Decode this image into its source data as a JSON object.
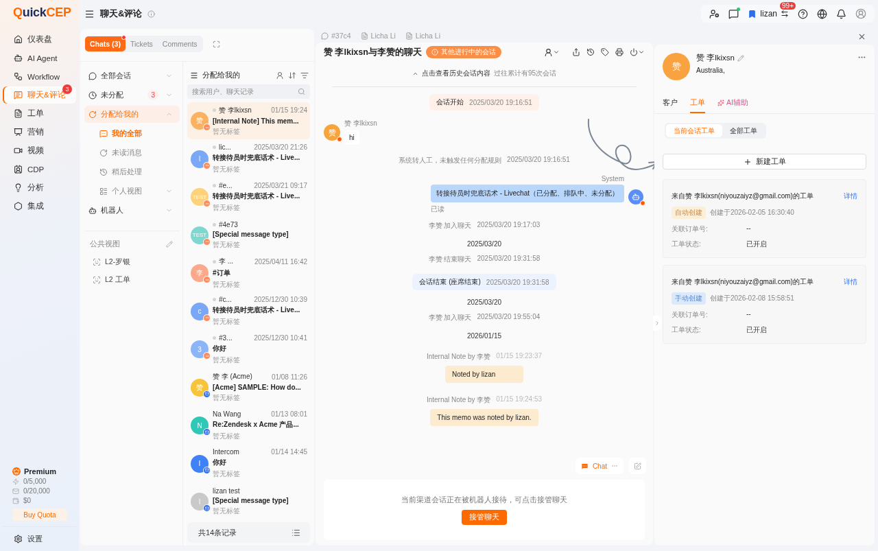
{
  "logo": {
    "mark": "Q",
    "rest": "uick",
    "accent": "CEP"
  },
  "nav": [
    {
      "label": "仪表盘",
      "selected": false
    },
    {
      "label": "AI Agent",
      "selected": false
    },
    {
      "label": "Workflow",
      "selected": false
    },
    {
      "label": "聊天&评论",
      "selected": true,
      "badge": "3"
    },
    {
      "label": "工单",
      "selected": false
    },
    {
      "label": "营销",
      "selected": false
    },
    {
      "label": "视频",
      "selected": false
    },
    {
      "label": "CDP",
      "selected": false
    },
    {
      "label": "分析",
      "selected": false
    },
    {
      "label": "集成",
      "selected": false
    }
  ],
  "plan": {
    "name": "Premium",
    "quotas": [
      "0/5,000",
      "0/20,000",
      "$0"
    ],
    "button": "Buy Quota"
  },
  "settings": "设置",
  "header": {
    "title": "聊天&评论",
    "user": "lizan",
    "notice_badge": "99+"
  },
  "panel_tabs": [
    {
      "label": "Chats (3)",
      "selected": true,
      "dot": true
    },
    {
      "label": "Tickets",
      "selected": false,
      "dot": false
    },
    {
      "label": "Comments",
      "selected": false,
      "dot": false
    }
  ],
  "folders": [
    {
      "label": "全部会话",
      "selected": false,
      "expanded": false
    },
    {
      "label": "未分配",
      "count": "3",
      "selected": false,
      "expanded": false
    },
    {
      "label": "分配给我的",
      "selected": true,
      "expanded": true,
      "children": [
        {
          "label": "我的全部",
          "selected": true
        },
        {
          "label": "未读消息",
          "selected": false
        },
        {
          "label": "稍后处理",
          "selected": false
        },
        {
          "label": "个人视图",
          "selected": false,
          "expanded": false
        }
      ]
    },
    {
      "label": "机器人",
      "selected": false,
      "expanded": false
    }
  ],
  "public_views": {
    "title": "公共视图",
    "items": [
      "L2-罗银",
      "L2 工单"
    ]
  },
  "conversations": {
    "title": "分配给我的",
    "placeholder": "搜索用户、聊天记录",
    "footer": "共14条记录",
    "items": [
      {
        "name": "赞 李lkixsn",
        "time": "01/15 19:24",
        "preview": "[Internal Note] This mem...",
        "tag": "暂无标签",
        "avatar": "赞",
        "color": "#f9b262",
        "kind": "chat",
        "status_dot": true,
        "selected": true
      },
      {
        "name": "lic...",
        "time": "2025/03/20 21:26",
        "preview": "转接待员时兜底话术 - Live...",
        "tag": "暂无标签",
        "avatar": "l",
        "color": "#7ba7f7",
        "kind": "chat",
        "status_dot": true,
        "selected": false
      },
      {
        "name": "#e...",
        "time": "2025/03/21 09:17",
        "preview": "转接待员时兜底话术 - Live...",
        "tag": "暂无标签",
        "avatar": "TEST",
        "color": "#fdd27a",
        "kind": "chat",
        "status_dot": true,
        "selected": false
      },
      {
        "name": "#4e73",
        "preview": "[Special message type]",
        "tag": "暂无标签",
        "avatar": "TEST",
        "color": "#7fd8cf",
        "kind": "chat",
        "status_dot": true,
        "selected": false
      },
      {
        "name": "李 ...",
        "time": "2025/04/11 16:42",
        "preview": "#订单",
        "tag": "暂无标签",
        "avatar": "李",
        "color": "#fba98a",
        "kind": "chat",
        "status_dot": true,
        "selected": false
      },
      {
        "name": "#c...",
        "time": "2025/12/30 10:39",
        "preview": "转接待员时兜底话术 - Live...",
        "tag": "暂无标签",
        "avatar": "c",
        "color": "#7ba7f7",
        "kind": "chat",
        "status_dot": true,
        "selected": false
      },
      {
        "name": "#3...",
        "time": "2025/12/30 10:41",
        "preview": "你好",
        "tag": "暂无标签",
        "avatar": "3",
        "color": "#8cb4f8",
        "kind": "chat",
        "status_dot": true,
        "selected": false
      },
      {
        "name": "赞 李 (Acme)",
        "time": "01/08 11:26",
        "preview": "[Acme] SAMPLE: How do...",
        "tag": "暂无标签",
        "avatar": "赞",
        "color": "#f7c33b",
        "kind": "email",
        "status_dot": false,
        "selected": false
      },
      {
        "name": "Na Wang",
        "time": "01/13 08:01",
        "preview": "Re:Zendesk x Acme 产品...",
        "tag": "暂无标签",
        "avatar": "N",
        "color": "#2fc7b6",
        "kind": "email",
        "status_dot": false,
        "selected": false
      },
      {
        "name": "Intercom",
        "time": "01/14 14:45",
        "preview": "你好",
        "tag": "暂无标签",
        "avatar": "I",
        "color": "#3f82f7",
        "kind": "email",
        "status_dot": false,
        "selected": false
      },
      {
        "name": "lizan test",
        "preview": "[Special message type]",
        "tag": "暂无标签",
        "avatar": "l",
        "color": "#c9c9c9",
        "kind": "email",
        "status_dot": false,
        "selected": false
      }
    ]
  },
  "doc_tabs": [
    {
      "label": "#37c4",
      "kind": "chat"
    },
    {
      "label": "Licha Li",
      "kind": "doc"
    },
    {
      "label": "Licha Li",
      "kind": "doc"
    }
  ],
  "chat": {
    "title": "赞 李lkixsn与李赞的聊天",
    "status_badge": "其他进行中的会话",
    "history_link": "点击查看历史会话内容",
    "history_count": "过往累计有95次会话",
    "messages": [
      {
        "kind": "start_event",
        "text": "会话开始",
        "time": "2025/03/20 19:16:51"
      },
      {
        "kind": "incoming",
        "sender": "赞 李lkixsn",
        "avatar": "赞",
        "text": "hi"
      },
      {
        "kind": "system",
        "text": "系统转人工，未触发任何分配规则",
        "time": "2025/03/20 19:16:51"
      },
      {
        "kind": "outgoing",
        "sender": "System",
        "text": "转接待员时兜底话术 - Livechat（已分配、排队中、未分配）",
        "status": "已读"
      },
      {
        "kind": "system",
        "text": "李赞 加入聊天",
        "time": "2025/03/20 19:17:03"
      },
      {
        "kind": "date",
        "text": "2025/03/20"
      },
      {
        "kind": "system",
        "text": "李赞 结束聊天",
        "time": "2025/03/20 19:31:58"
      },
      {
        "kind": "end_event",
        "text": "会话结束 (座席结束)",
        "time": "2025/03/20 19:31:58"
      },
      {
        "kind": "date",
        "text": "2025/03/20"
      },
      {
        "kind": "system",
        "text": "李赞 加入聊天",
        "time": "2025/03/20 19:55:04"
      },
      {
        "kind": "date",
        "text": "2026/01/15"
      },
      {
        "kind": "note",
        "sender": "Internal Note by 李赞",
        "time": "01/15 19:23:37",
        "text": "Noted by lizan"
      },
      {
        "kind": "note",
        "sender": "Internal Note by 李赞",
        "time": "01/15 19:24:53",
        "text": "This memo was noted by lizan."
      }
    ],
    "channel_chip": "Chat",
    "notice": "当前渠道会话正在被机器人接待，可点击接管聊天",
    "takeover": "接管聊天"
  },
  "profile": {
    "avatar": "赞",
    "name": "赞 李lkixsn",
    "location": "Australia,",
    "tabs": [
      {
        "label": "客户",
        "selected": false,
        "kind": "plain"
      },
      {
        "label": "工单",
        "selected": true,
        "kind": "plain"
      },
      {
        "label": "AI辅助",
        "selected": false,
        "kind": "ai"
      }
    ],
    "segments": [
      {
        "label": "当前会话工单",
        "selected": true
      },
      {
        "label": "全部工单",
        "selected": false
      }
    ],
    "new_ticket": "新建工单",
    "tickets": [
      {
        "title": "来自赞 李lkixsn(niyouzaiyz@gmail.com)的工单",
        "link": "详情",
        "origin": "自动创建",
        "kind": "auto",
        "created": "创建于2026-02-05 16:30:40",
        "fields": [
          {
            "label": "关联订单号:",
            "value": "--"
          },
          {
            "label": "工单状态:",
            "value": "已开启"
          }
        ]
      },
      {
        "title": "来自赞 李lkixsn(niyouzaiyz@gmail.com)的工单",
        "link": "详情",
        "origin": "手动创建",
        "kind": "manual",
        "created": "创建于2026-02-08 15:58:51",
        "fields": [
          {
            "label": "关联订单号:",
            "value": "--"
          },
          {
            "label": "工单状态:",
            "value": "已开启"
          }
        ]
      }
    ]
  }
}
